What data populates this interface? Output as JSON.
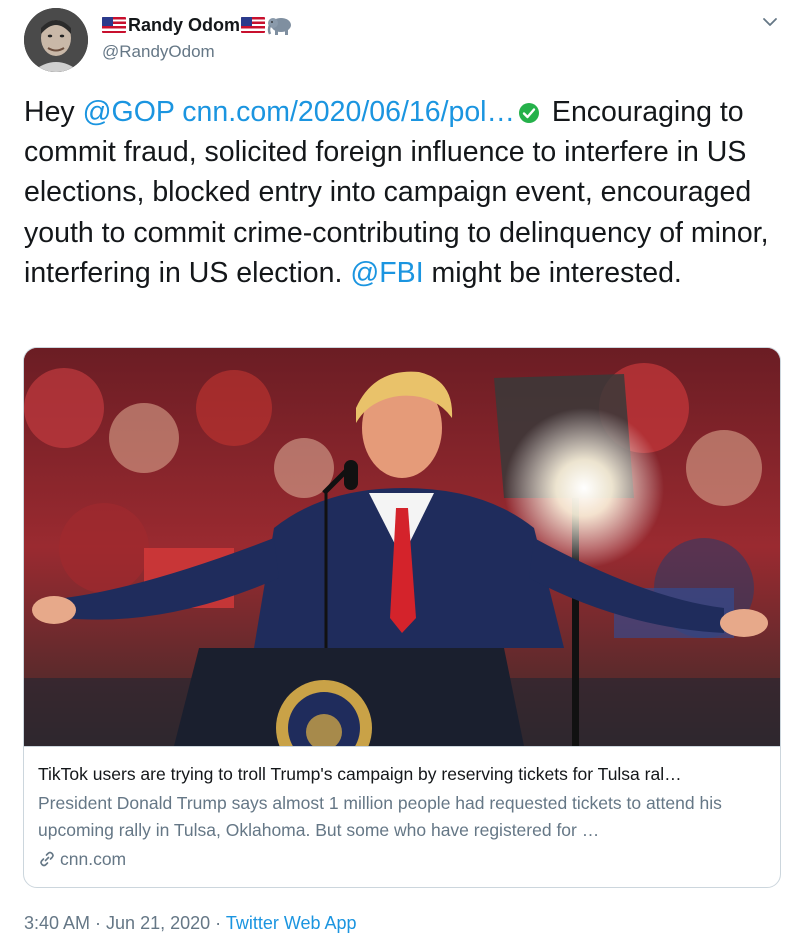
{
  "author": {
    "display_name": "Randy Odom",
    "handle": "@RandyOdom",
    "name_decorations": [
      "us-flag-icon",
      "us-flag-icon",
      "elephant-icon"
    ]
  },
  "tweet": {
    "greeting": "Hey",
    "mention_gop": "@GOP",
    "link_text": "cnn.com/2020/06/16/pol…",
    "body_1": " Encouraging to commit fraud, solicited foreign influence to interfere in US elections, blocked entry into campaign event, encouraged youth to commit crime-contributing to delinquency of minor, interfering in US election.",
    "mention_fbi": "@FBI",
    "body_2": "might be interested."
  },
  "card": {
    "title": "TikTok users are trying to troll Trump's campaign by reserving tickets for Tulsa ral…",
    "description": "President Donald Trump says almost 1 million people had requested tickets to attend his upcoming rally in Tulsa, Oklahoma. But some who have registered for …",
    "domain": "cnn.com",
    "image_icon": "photo-rally-speaker"
  },
  "meta": {
    "time": "3:40 AM",
    "separator_1": " · ",
    "date": "Jun 21, 2020",
    "separator_2": " · ",
    "source": "Twitter Web App"
  },
  "colors": {
    "link": "#1b95e0",
    "text": "#14171a",
    "secondary": "#657786",
    "border": "#ccd6dd"
  }
}
